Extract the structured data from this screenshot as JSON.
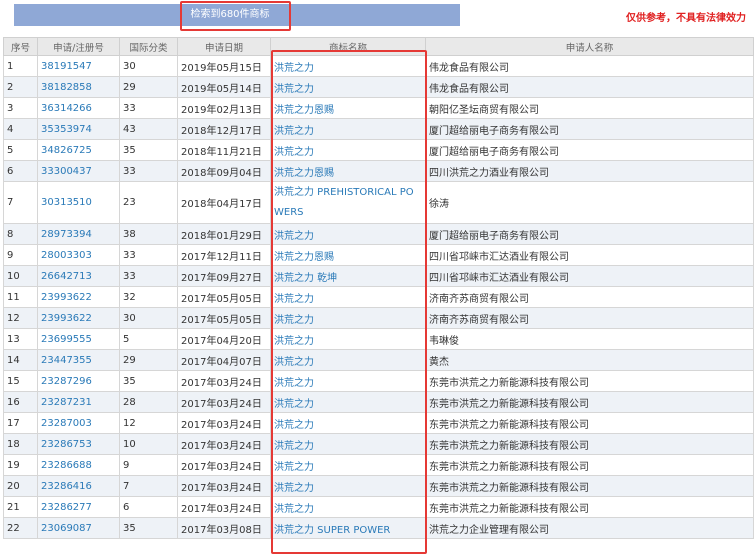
{
  "banner": {
    "label": "检索到680件商标"
  },
  "disclaimer": "仅供参考，不具有法律效力",
  "table": {
    "headers": [
      "序号",
      "申请/注册号",
      "国际分类",
      "申请日期",
      "商标名称",
      "申请人名称"
    ],
    "rows": [
      [
        "1",
        "38191547",
        "30",
        "2019年05月15日",
        "洪荒之力",
        "伟龙食品有限公司"
      ],
      [
        "2",
        "38182858",
        "29",
        "2019年05月14日",
        "洪荒之力",
        "伟龙食品有限公司"
      ],
      [
        "3",
        "36314266",
        "33",
        "2019年02月13日",
        "洪荒之力恩赐",
        "朝阳亿圣坛商贸有限公司"
      ],
      [
        "4",
        "35353974",
        "43",
        "2018年12月17日",
        "洪荒之力",
        "厦门超给丽电子商务有限公司"
      ],
      [
        "5",
        "34826725",
        "35",
        "2018年11月21日",
        "洪荒之力",
        "厦门超给丽电子商务有限公司"
      ],
      [
        "6",
        "33300437",
        "33",
        "2018年09月04日",
        "洪荒之力恩赐",
        "四川洪荒之力酒业有限公司"
      ],
      [
        "7",
        "30313510",
        "23",
        "2018年04月17日",
        "洪荒之力 PREHISTORICAL POWERS",
        "徐涛"
      ],
      [
        "8",
        "28973394",
        "38",
        "2018年01月29日",
        "洪荒之力",
        "厦门超给丽电子商务有限公司"
      ],
      [
        "9",
        "28003303",
        "33",
        "2017年12月11日",
        "洪荒之力恩赐",
        "四川省邛崃市汇达酒业有限公司"
      ],
      [
        "10",
        "26642713",
        "33",
        "2017年09月27日",
        "洪荒之力 乾坤",
        "四川省邛崃市汇达酒业有限公司"
      ],
      [
        "11",
        "23993622",
        "32",
        "2017年05月05日",
        "洪荒之力",
        "济南齐苏商贸有限公司"
      ],
      [
        "12",
        "23993622",
        "30",
        "2017年05月05日",
        "洪荒之力",
        "济南齐苏商贸有限公司"
      ],
      [
        "13",
        "23699555",
        "5",
        "2017年04月20日",
        "洪荒之力",
        "韦琳俊"
      ],
      [
        "14",
        "23447355",
        "29",
        "2017年04月07日",
        "洪荒之力",
        "黄杰"
      ],
      [
        "15",
        "23287296",
        "35",
        "2017年03月24日",
        "洪荒之力",
        "东莞市洪荒之力新能源科技有限公司"
      ],
      [
        "16",
        "23287231",
        "28",
        "2017年03月24日",
        "洪荒之力",
        "东莞市洪荒之力新能源科技有限公司"
      ],
      [
        "17",
        "23287003",
        "12",
        "2017年03月24日",
        "洪荒之力",
        "东莞市洪荒之力新能源科技有限公司"
      ],
      [
        "18",
        "23286753",
        "10",
        "2017年03月24日",
        "洪荒之力",
        "东莞市洪荒之力新能源科技有限公司"
      ],
      [
        "19",
        "23286688",
        "9",
        "2017年03月24日",
        "洪荒之力",
        "东莞市洪荒之力新能源科技有限公司"
      ],
      [
        "20",
        "23286416",
        "7",
        "2017年03月24日",
        "洪荒之力",
        "东莞市洪荒之力新能源科技有限公司"
      ],
      [
        "21",
        "23286277",
        "6",
        "2017年03月24日",
        "洪荒之力",
        "东莞市洪荒之力新能源科技有限公司"
      ],
      [
        "22",
        "23069087",
        "35",
        "2017年03月08日",
        "洪荒之力 SUPER POWER",
        "洪荒之力企业管理有限公司"
      ]
    ]
  },
  "colors": {
    "link": "#2a7ab8",
    "highlight": "#e53935",
    "banner": "#8fa8d6"
  }
}
